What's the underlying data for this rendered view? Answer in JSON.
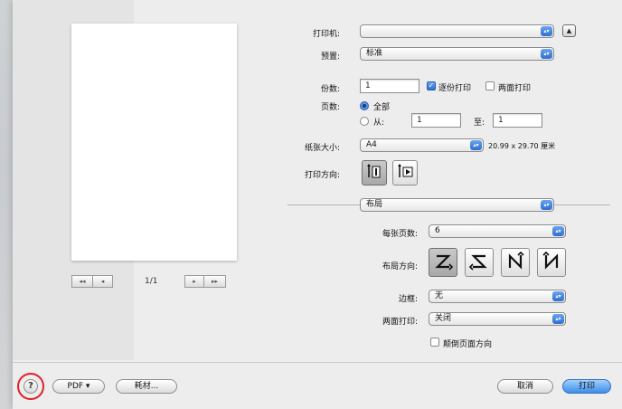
{
  "printer": {
    "label": "打印机:",
    "value": ""
  },
  "preset": {
    "label": "预置:",
    "value": "标准"
  },
  "copies": {
    "label": "份数:",
    "value": "1",
    "collate_label": "逐份打印",
    "collate_checked": true,
    "duplex_label": "两面打印",
    "duplex_checked": false
  },
  "pages": {
    "label": "页数:",
    "all_label": "全部",
    "from_label": "从:",
    "from_value": "1",
    "to_label": "至:",
    "to_value": "1",
    "selected": "all"
  },
  "paper_size": {
    "label": "纸张大小:",
    "value": "A4",
    "dimensions": "20.99 x 29.70 厘米"
  },
  "orientation": {
    "label": "打印方向:",
    "selected": "portrait"
  },
  "section_menu": {
    "value": "布局"
  },
  "pages_per_sheet": {
    "label": "每张页数:",
    "value": "6"
  },
  "layout_direction": {
    "label": "布局方向:",
    "options": [
      "z-icon",
      "reverse-z-icon",
      "n-icon",
      "reverse-n-icon"
    ],
    "selected": 0
  },
  "border": {
    "label": "边框:",
    "value": "无"
  },
  "two_sided": {
    "label": "两面打印:",
    "value": "关闭"
  },
  "flip": {
    "label": "颠倒页面方向",
    "checked": false
  },
  "preview": {
    "page_indicator": "1/1"
  },
  "bottom_bar": {
    "pdf_label": "PDF ▾",
    "supplies_label": "耗材...",
    "cancel_label": "取消",
    "print_label": "打印",
    "help_label": "?"
  },
  "colors": {
    "accent": "#3f8de8",
    "highlight_ring": "#e0202a"
  }
}
